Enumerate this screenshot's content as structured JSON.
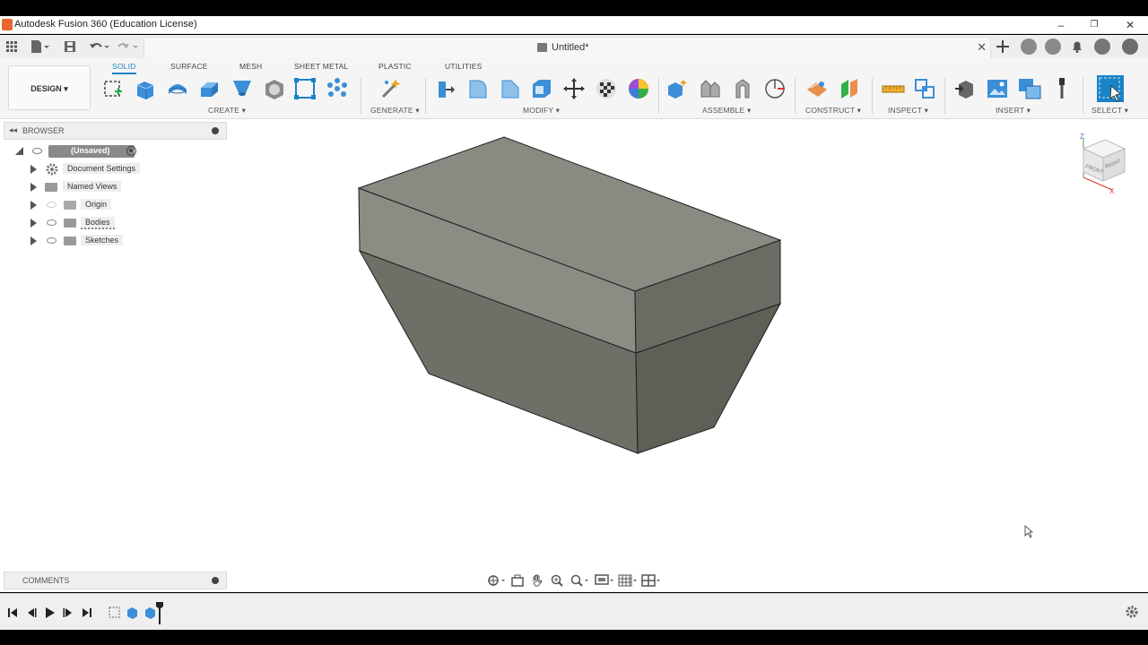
{
  "window": {
    "title": "Autodesk Fusion 360 (Education License)",
    "minimize": "–",
    "restore": "❐",
    "close": "✕"
  },
  "document_tab": {
    "title": "Untitled*",
    "close": "✕"
  },
  "workspace": {
    "label": "DESIGN ▾"
  },
  "ribbon_tabs": [
    "SOLID",
    "SURFACE",
    "MESH",
    "SHEET METAL",
    "PLASTIC",
    "UTILITIES"
  ],
  "active_tab": "SOLID",
  "tool_groups": [
    {
      "label": "CREATE ▾"
    },
    {
      "label": "GENERATE ▾"
    },
    {
      "label": "MODIFY ▾"
    },
    {
      "label": "ASSEMBLE ▾"
    },
    {
      "label": "CONSTRUCT ▾"
    },
    {
      "label": "INSPECT ▾"
    },
    {
      "label": "INSERT ▾"
    },
    {
      "label": "SELECT ▾"
    }
  ],
  "browser": {
    "title": "BROWSER",
    "root": "(Unsaved)",
    "items": [
      {
        "label": "Document Settings",
        "icon": "gear-icon"
      },
      {
        "label": "Named Views",
        "icon": "folder-icon"
      },
      {
        "label": "Origin",
        "icon": "folder-icon"
      },
      {
        "label": "Bodies",
        "icon": "folder-icon"
      },
      {
        "label": "Sketches",
        "icon": "folder-icon"
      }
    ]
  },
  "comments": {
    "title": "COMMENTS"
  },
  "viewcube": {
    "front": "FRONT",
    "right": "RIGHT",
    "z_axis": "Z",
    "x_axis": "X"
  },
  "colors": {
    "accent": "#1a83c6",
    "model_top": "#8f8f87",
    "model_front": "#707068",
    "model_side": "#62625a"
  }
}
